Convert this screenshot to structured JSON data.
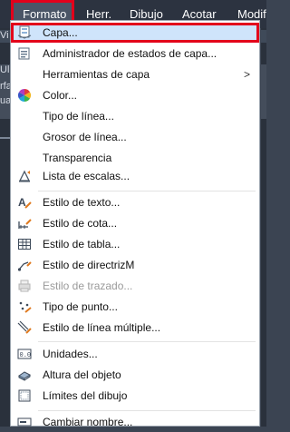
{
  "menubar": {
    "items": [
      {
        "label": "Formato",
        "active": true
      },
      {
        "label": "Herr."
      },
      {
        "label": "Dibujo"
      },
      {
        "label": "Acotar"
      },
      {
        "label": "Modif"
      }
    ]
  },
  "background": {
    "fragments": [
      "Vi",
      "Ul",
      "rfa",
      "ua"
    ]
  },
  "menu": {
    "items": [
      {
        "label": "Capa...",
        "icon": "layer-properties-icon",
        "highlight": true
      },
      {
        "label": "Administrador de estados de capa...",
        "icon": "layer-states-icon"
      },
      {
        "label": "Herramientas de capa",
        "icon": "none",
        "submenu_arrow": ">"
      },
      {
        "label": "Color...",
        "icon": "color-wheel-icon"
      },
      {
        "label": "Tipo de línea...",
        "icon": "none"
      },
      {
        "label": "Grosor de línea...",
        "icon": "none"
      },
      {
        "label": "Transparencia",
        "icon": "none"
      },
      {
        "label": "Lista de escalas...",
        "icon": "scale-list-icon"
      },
      {
        "label": "Estilo de texto...",
        "icon": "text-style-icon"
      },
      {
        "label": "Estilo de cota...",
        "icon": "dimension-style-icon"
      },
      {
        "label": "Estilo de tabla...",
        "icon": "table-style-icon"
      },
      {
        "label": "Estilo de directrizM",
        "icon": "multileader-style-icon"
      },
      {
        "label": "Estilo de trazado...",
        "icon": "plot-style-icon",
        "disabled": true
      },
      {
        "label": "Tipo de punto...",
        "icon": "point-style-icon"
      },
      {
        "label": "Estilo de línea múltiple...",
        "icon": "multiline-style-icon"
      },
      {
        "label": "Unidades...",
        "icon": "units-icon"
      },
      {
        "label": "Altura del objeto",
        "icon": "thickness-icon"
      },
      {
        "label": "Límites del dibujo",
        "icon": "drawing-limits-icon"
      },
      {
        "label": "Cambiar nombre...",
        "icon": "rename-icon"
      }
    ]
  },
  "colors": {
    "highlight": "#cfe4fb",
    "callout": "#e3001b",
    "menubar": "#2c3340"
  }
}
